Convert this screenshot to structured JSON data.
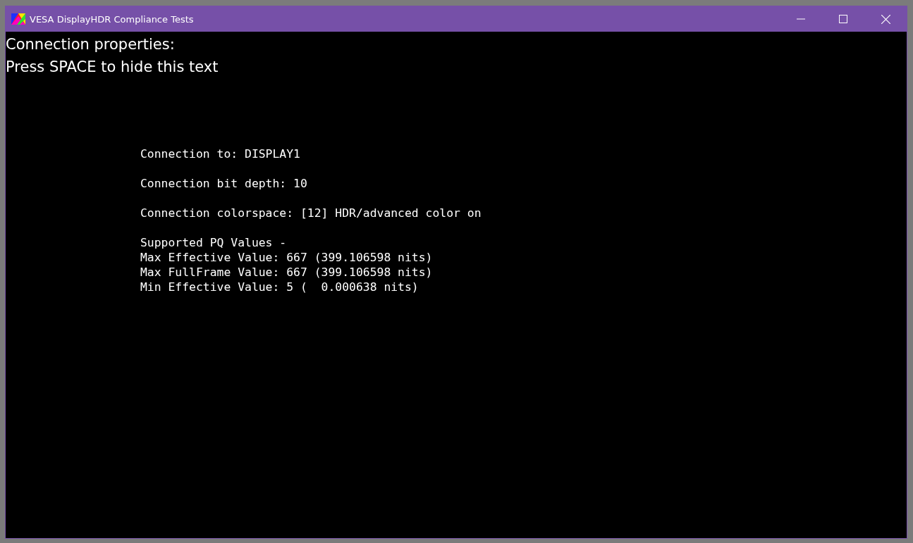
{
  "window": {
    "title": "VESA DisplayHDR Compliance Tests"
  },
  "header_lines": [
    "Connection properties:",
    "Press SPACE to hide this text"
  ],
  "info_blocks": [
    [
      "Connection to: DISPLAY1"
    ],
    [
      "Connection bit depth: 10"
    ],
    [
      "Connection colorspace: [12] HDR/advanced color on"
    ],
    [
      "Supported PQ Values -",
      "Max Effective Value: 667 (399.106598 nits)",
      "Max FullFrame Value: 667 (399.106598 nits)",
      "Min Effective Value: 5 (  0.000638 nits)"
    ]
  ]
}
